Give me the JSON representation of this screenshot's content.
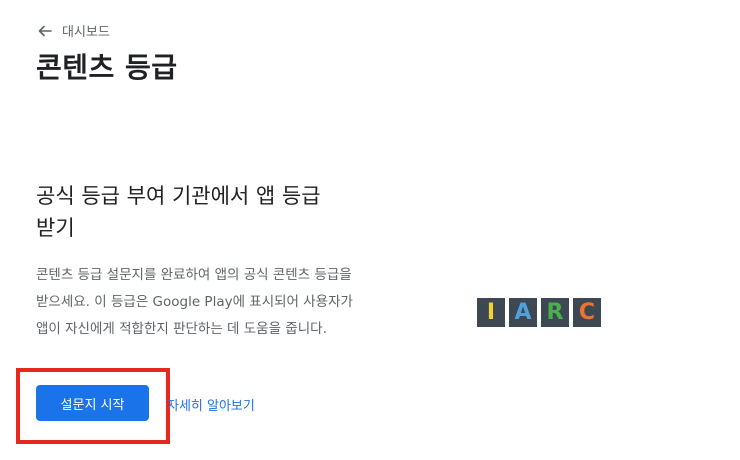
{
  "breadcrumb": {
    "back_icon": "arrow-left-icon",
    "label": "대시보드"
  },
  "page": {
    "title": "콘텐츠 등급"
  },
  "section": {
    "heading": "공식 등급 부여 기관에서 앱 등급 받기",
    "body": "콘텐츠 등급 설문지를 완료하여 앱의 공식 콘텐츠 등급을 받으세요. 이 등급은 Google Play에 표시되어 사용자가 앱이 자신에게 적합한지 판단하는 데 도움을 줍니다.",
    "primary_button": "설문지 시작",
    "learn_more": "자세히 알아보기"
  },
  "iarc_logo": {
    "letters": [
      {
        "char": "I",
        "color": "#f2d230"
      },
      {
        "char": "A",
        "color": "#4fa0dc"
      },
      {
        "char": "R",
        "color": "#4cae4f"
      },
      {
        "char": "C",
        "color": "#ed7331"
      }
    ],
    "tile_color": "#3d4852"
  },
  "colors": {
    "accent": "#1a73e8",
    "highlight": "#e8271e",
    "text_primary": "#202124",
    "text_secondary": "#5f6368"
  }
}
